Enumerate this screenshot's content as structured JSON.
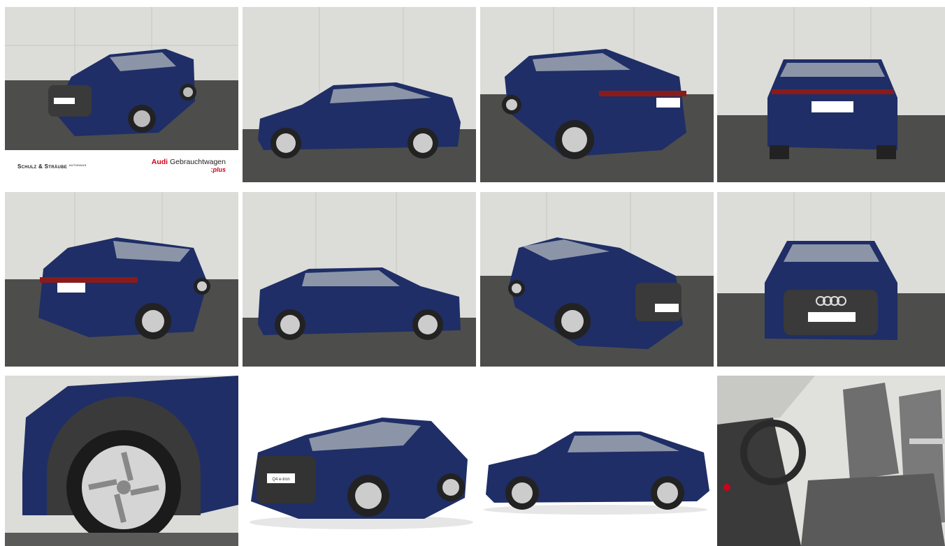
{
  "dealer": {
    "name": "Schulz & Sträube",
    "name_small": "AUTOHAUS",
    "brand": "Audi",
    "program": "Gebrauchtwagen",
    "program_suffix": ":plus"
  },
  "plate": {
    "label": ":plus",
    "studio_badge": "Q4 e-tron"
  },
  "colors": {
    "car_body": "#1f2e66",
    "wall": "#dcdcd9",
    "floor": "#4d4d4b",
    "brand_red": "#d0021b"
  },
  "photos": [
    {
      "name": "front-three-quarter-left"
    },
    {
      "name": "side-left"
    },
    {
      "name": "rear-three-quarter-left"
    },
    {
      "name": "rear"
    },
    {
      "name": "rear-three-quarter-right"
    },
    {
      "name": "side-right"
    },
    {
      "name": "front-three-quarter-right"
    },
    {
      "name": "front"
    },
    {
      "name": "wheel-detail"
    },
    {
      "name": "studio-front-three-quarter"
    },
    {
      "name": "studio-side"
    },
    {
      "name": "interior-seats"
    }
  ]
}
